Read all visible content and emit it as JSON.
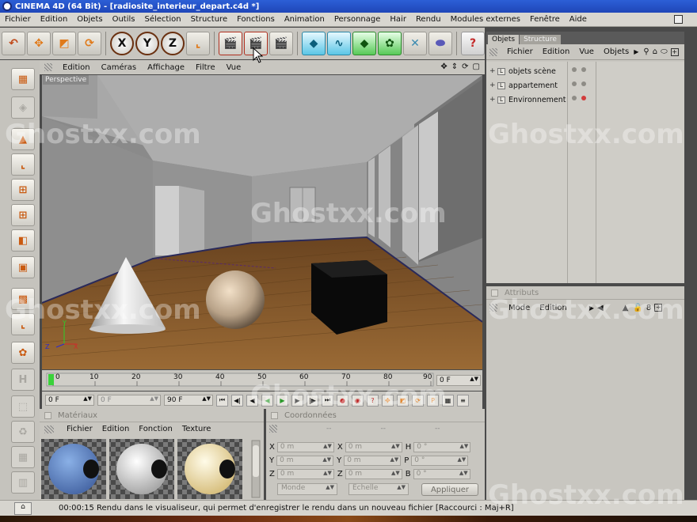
{
  "window": {
    "title": "CINEMA 4D (64 Bit) - [radiosite_interieur_depart.c4d *]"
  },
  "menu": [
    "Fichier",
    "Edition",
    "Objets",
    "Outils",
    "Sélection",
    "Structure",
    "Fonctions",
    "Animation",
    "Personnage",
    "Hair",
    "Rendu",
    "Modules externes",
    "Fenêtre",
    "Aide"
  ],
  "toolbar": {
    "axis_x": "X",
    "axis_y": "Y",
    "axis_z": "Z",
    "help": "?"
  },
  "viewport": {
    "menu": [
      "Edition",
      "Caméras",
      "Affichage",
      "Filtre",
      "Vue"
    ],
    "label": "Perspective",
    "nav_icons": [
      "move-view-icon",
      "scale-view-icon",
      "rotate-view-icon",
      "maximize-view-icon"
    ]
  },
  "timeline": {
    "ticks": [
      "0",
      "10",
      "20",
      "30",
      "40",
      "50",
      "60",
      "70",
      "80",
      "90"
    ],
    "current_frame": "0 F",
    "start_frame": "0 F",
    "preview_frame": "0 F",
    "end_frame": "90 F"
  },
  "materials": {
    "title": "Matériaux",
    "menu": [
      "Fichier",
      "Edition",
      "Fonction",
      "Texture"
    ],
    "swatch_colors": [
      "#6a8fc9",
      "#ececec",
      "#f0e0b0"
    ]
  },
  "coordinates": {
    "title": "Coordonnées",
    "header": [
      "--",
      "--",
      "--"
    ],
    "rows": [
      {
        "a_label": "X",
        "a_value": "0 m",
        "b_label": "X",
        "b_value": "0 m",
        "c_label": "H",
        "c_value": "0 °"
      },
      {
        "a_label": "Y",
        "a_value": "0 m",
        "b_label": "Y",
        "b_value": "0 m",
        "c_label": "P",
        "c_value": "0 °"
      },
      {
        "a_label": "Z",
        "a_value": "0 m",
        "b_label": "Z",
        "b_value": "0 m",
        "c_label": "B",
        "c_value": "0 °"
      }
    ],
    "mode_select": "Monde",
    "scale_select": "Echelle",
    "apply_label": "Appliquer"
  },
  "objects": {
    "tabs": [
      "Objets",
      "Structure"
    ],
    "menu": [
      "Fichier",
      "Edition",
      "Vue",
      "Objets"
    ],
    "items": [
      {
        "label": "objets scène",
        "flag": "none"
      },
      {
        "label": "appartement",
        "flag": "none"
      },
      {
        "label": "Environnement",
        "flag": "red"
      }
    ]
  },
  "attributes": {
    "title": "Attributs",
    "menu": [
      "Mode",
      "Edition"
    ]
  },
  "status": {
    "time": "00:00:15",
    "message": "Rendu dans le visualiseur, qui permet d'enregistrer le rendu dans un nouveau fichier [Raccourci : Maj+R]"
  },
  "watermark": "Ghostxx.com",
  "colors": {
    "accent": "#e07a1a",
    "titlebar": "#2c5fd6",
    "panel": "#c8c6c0",
    "floor": "#8a5a2a"
  }
}
